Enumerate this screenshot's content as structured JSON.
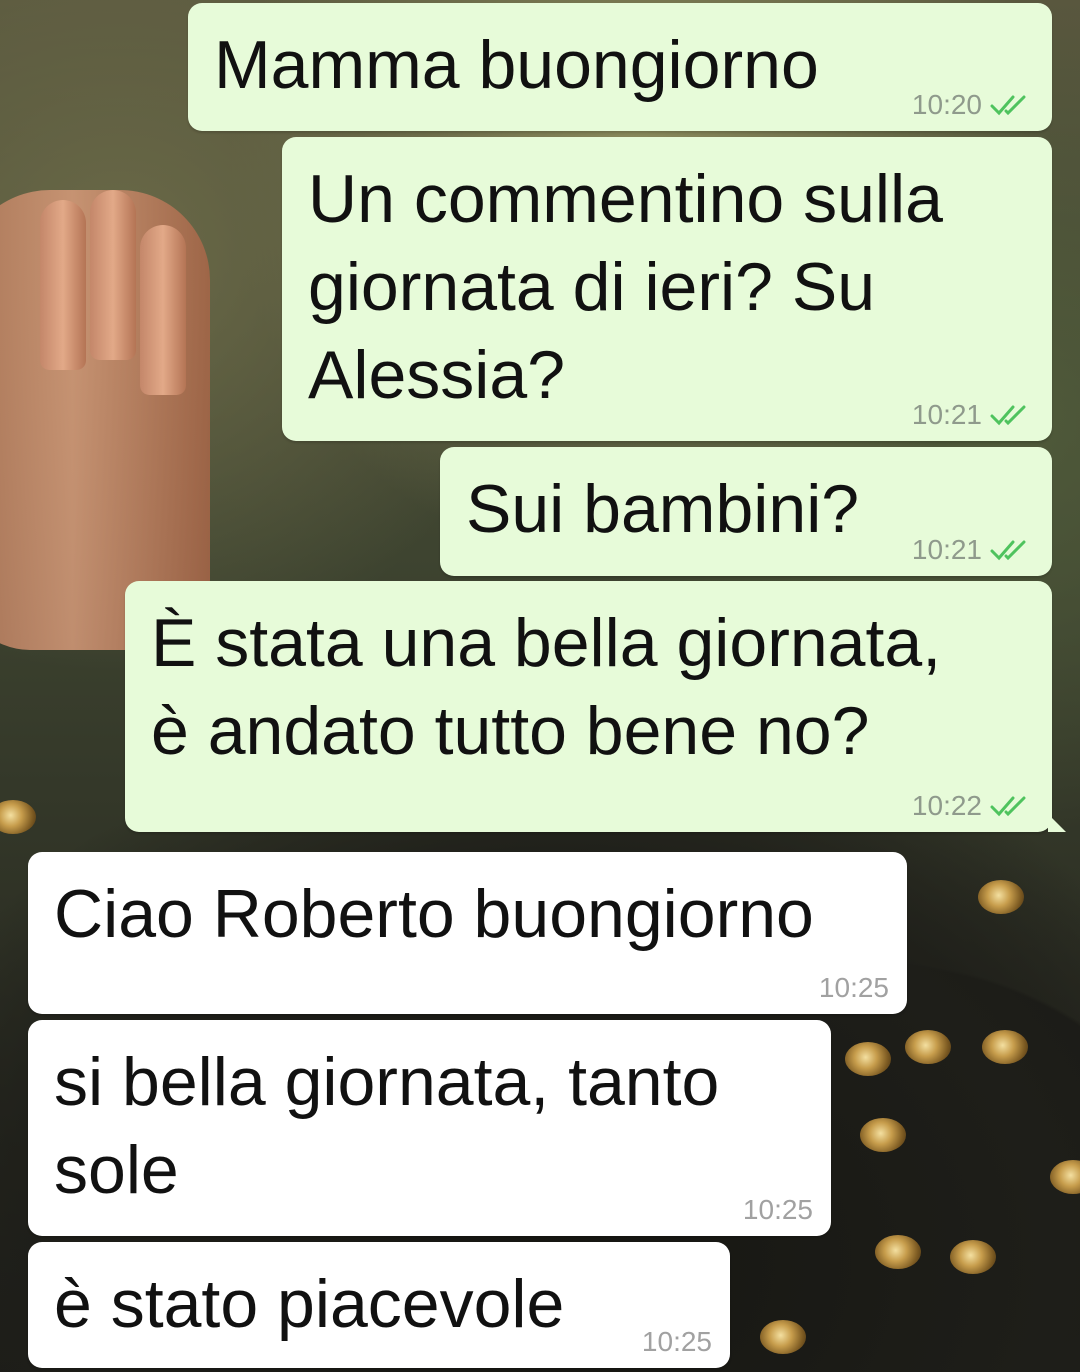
{
  "messages": [
    {
      "direction": "out",
      "text": "Mamma buongiorno",
      "time": "10:20",
      "status_icon": "double-check-icon",
      "status_color": "#4fc35e"
    },
    {
      "direction": "out",
      "text": "Un commentino sulla\ngiornata di ieri? Su\nAlessia?",
      "time": "10:21",
      "status_icon": "double-check-icon",
      "status_color": "#4fc35e"
    },
    {
      "direction": "out",
      "text": "Sui bambini?",
      "time": "10:21",
      "status_icon": "double-check-icon",
      "status_color": "#4fc35e"
    },
    {
      "direction": "out",
      "text": "È stata una bella giornata,\nè andato tutto bene no?",
      "time": "10:22",
      "status_icon": "double-check-icon",
      "status_color": "#4fc35e"
    },
    {
      "direction": "in",
      "text": "Ciao Roberto buongiorno",
      "time": "10:25"
    },
    {
      "direction": "in",
      "text": "si bella giornata, tanto\nsole",
      "time": "10:25"
    },
    {
      "direction": "in",
      "text": "è stato piacevole",
      "time": "10:25"
    }
  ],
  "colors": {
    "outgoing_bubble": "#e7fbd9",
    "incoming_bubble": "#ffffff",
    "read_ticks": "#4fc35e"
  }
}
